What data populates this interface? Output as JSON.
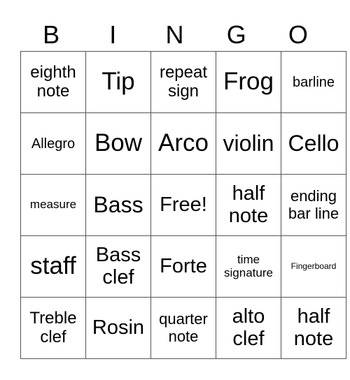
{
  "header": [
    "B",
    "I",
    "N",
    "G",
    "O"
  ],
  "rows": [
    [
      "eighth note",
      "Tip",
      "repeat sign",
      "Frog",
      "barline"
    ],
    [
      "Allegro",
      "Bow",
      "Arco",
      "violin",
      "Cello"
    ],
    [
      "measure",
      "Bass",
      "Free!",
      "half note",
      "ending bar line"
    ],
    [
      "staff",
      "Bass clef",
      "Forte",
      "time signature",
      "Fingerboard"
    ],
    [
      "Treble clef",
      "Rosin",
      "quarter note",
      "alto clef",
      "half note"
    ]
  ]
}
